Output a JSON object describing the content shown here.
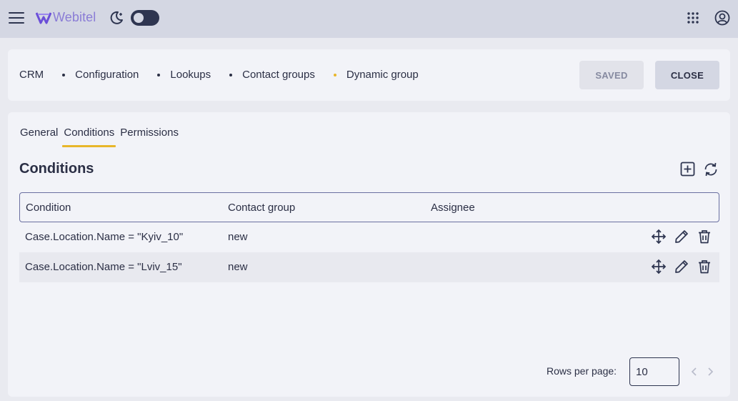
{
  "topbar": {
    "logo_text": "Webitel",
    "icons": [
      "menu-icon",
      "webitel-logo-icon",
      "moon-icon",
      "apps-grid-icon",
      "account-icon"
    ]
  },
  "breadcrumb": {
    "items": [
      "CRM",
      "Configuration",
      "Lookups",
      "Contact groups",
      "Dynamic group"
    ]
  },
  "actions": {
    "saved_label": "SAVED",
    "close_label": "CLOSE"
  },
  "tabs": [
    {
      "label": "General"
    },
    {
      "label": "Conditions"
    },
    {
      "label": "Permissions"
    }
  ],
  "section": {
    "title": "Conditions"
  },
  "table": {
    "headers": [
      "Condition",
      "Contact group",
      "Assignee"
    ],
    "rows": [
      {
        "condition": "Case.Location.Name = \"Kyiv_10\"",
        "contact_group": "new",
        "assignee": ""
      },
      {
        "condition": "Case.Location.Name = \"Lviv_15\"",
        "contact_group": "new",
        "assignee": ""
      }
    ]
  },
  "pagination": {
    "rows_per_page_label": "Rows per page:",
    "rows_per_page_value": "10"
  },
  "colors": {
    "accent": "#e8b62a",
    "topbar_bg": "#d4d7e3",
    "panel_bg": "#f2f3f8",
    "text": "#2b2f45",
    "logo": "#8a7cd6"
  }
}
